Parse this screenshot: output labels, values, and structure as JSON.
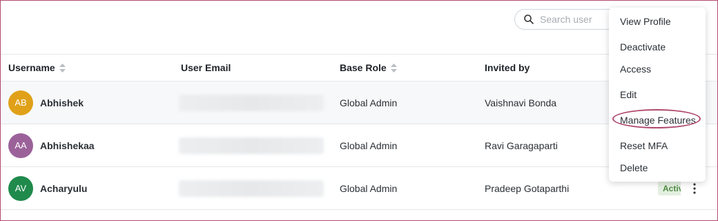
{
  "search": {
    "placeholder": "Search user"
  },
  "table": {
    "columns": {
      "username": "Username",
      "email": "User Email",
      "base_role": "Base Role",
      "invited_by": "Invited by"
    },
    "rows": [
      {
        "initials": "AB",
        "avatar_color": "#e0a119",
        "username": "Abhishek",
        "base_role": "Global Admin",
        "invited_by": "Vaishnavi Bonda"
      },
      {
        "initials": "AA",
        "avatar_color": "#9b629a",
        "username": "Abhishekaa",
        "base_role": "Global Admin",
        "invited_by": "Ravi Garagaparti"
      },
      {
        "initials": "AV",
        "avatar_color": "#1f8a4c",
        "username": "Acharyulu",
        "base_role": "Global Admin",
        "invited_by": "Pradeep Gotaparthi",
        "status": "Activ"
      }
    ]
  },
  "menu": {
    "items": [
      "View Profile",
      "Deactivate",
      "Access",
      "Edit",
      "Manage Features",
      "Reset MFA",
      "Delete"
    ],
    "highlighted": "Manage Features"
  },
  "colors": {
    "highlight": "#b0496f",
    "border": "#b0496f"
  },
  "icons": {
    "search": "search-icon",
    "sort": "sort-icon",
    "more": "more-vertical-icon"
  }
}
